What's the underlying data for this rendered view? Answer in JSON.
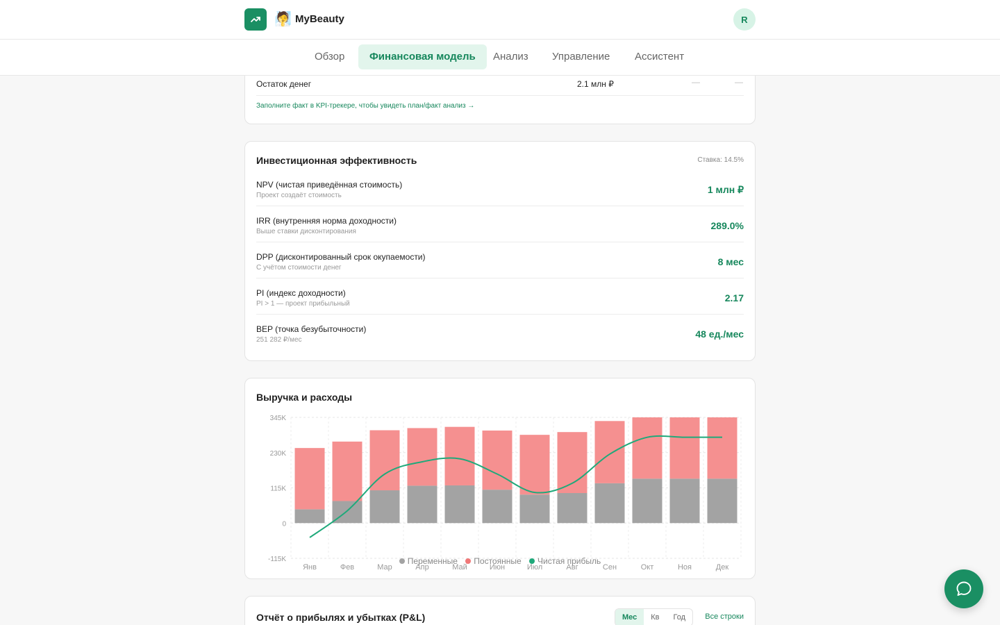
{
  "header": {
    "brand_emoji": "🧖",
    "brand_name": "MyBeauty",
    "avatar_initial": "R",
    "accent_color": "#1a8f63"
  },
  "tabs": [
    {
      "label": "Обзор",
      "active": false
    },
    {
      "label": "Финансовая модель",
      "active": true
    },
    {
      "label": "Анализ",
      "active": false
    },
    {
      "label": "Управление",
      "active": false
    },
    {
      "label": "Ассистент",
      "active": false
    }
  ],
  "cash_card": {
    "row_label": "Остаток денег",
    "row_value": "2.1 млн ₽",
    "dash1": "—",
    "dash2": "—",
    "link": "Заполните факт в KPI-трекере, чтобы увидеть план/факт анализ →"
  },
  "investment": {
    "title": "Инвестиционная эффективность",
    "rate": "Ставка: 14.5%",
    "metrics": [
      {
        "label": "NPV (чистая приведённая стоимость)",
        "sub": "Проект создаёт стоимость",
        "value": "1 млн ₽"
      },
      {
        "label": "IRR (внутренняя норма доходности)",
        "sub": "Выше ставки дисконтирования",
        "value": "289.0%"
      },
      {
        "label": "DPP (дисконтированный срок окупаемости)",
        "sub": "С учётом стоимости денег",
        "value": "8 мес"
      },
      {
        "label": "PI (индекс доходности)",
        "sub": "PI > 1 — проект прибыльный",
        "value": "2.17"
      },
      {
        "label": "BEP (точка безубыточности)",
        "sub": "251 282 ₽/мес",
        "value": "48 ед./мес"
      }
    ]
  },
  "revenue_chart": {
    "title": "Выручка и расходы",
    "legend": [
      {
        "name": "Переменные",
        "color": "#a3a3a3"
      },
      {
        "name": "Постоянные",
        "color": "#f59090"
      },
      {
        "name": "Чистая прибыль",
        "color": "#1fa97a"
      }
    ]
  },
  "chart_data": {
    "type": "bar",
    "stacked": true,
    "categories": [
      "Янв",
      "Фев",
      "Мар",
      "Апр",
      "Май",
      "Июн",
      "Июл",
      "Авг",
      "Сен",
      "Окт",
      "Ноя",
      "Дек"
    ],
    "series": [
      {
        "name": "Переменные",
        "type": "bar",
        "color": "#a3a3a3",
        "values": [
          45000,
          72000,
          107000,
          122000,
          123000,
          109000,
          93000,
          98000,
          130000,
          145000,
          145000,
          145000
        ]
      },
      {
        "name": "Постоянные",
        "type": "bar",
        "color": "#f59090",
        "values": [
          200000,
          194000,
          196000,
          188000,
          191000,
          193000,
          195000,
          199000,
          203000,
          200000,
          200000,
          200000
        ]
      },
      {
        "name": "Чистая прибыль",
        "type": "line",
        "color": "#1fa97a",
        "values": [
          -47000,
          40000,
          160000,
          200000,
          210000,
          160000,
          100000,
          130000,
          225000,
          280000,
          280000,
          280000
        ]
      }
    ],
    "yticks": [
      "345K",
      "230K",
      "115K",
      "0",
      "-115K"
    ],
    "ylim": [
      -115000,
      345000
    ],
    "grid": true,
    "legend_position": "bottom"
  },
  "pnl": {
    "title": "Отчёт о прибылях и убытках (P&L)",
    "periods": [
      {
        "label": "Мес",
        "active": true
      },
      {
        "label": "Кв",
        "active": false
      },
      {
        "label": "Год",
        "active": false
      }
    ],
    "all_rows": "Все строки"
  },
  "chat": {
    "icon": "chat-bubble-icon"
  }
}
